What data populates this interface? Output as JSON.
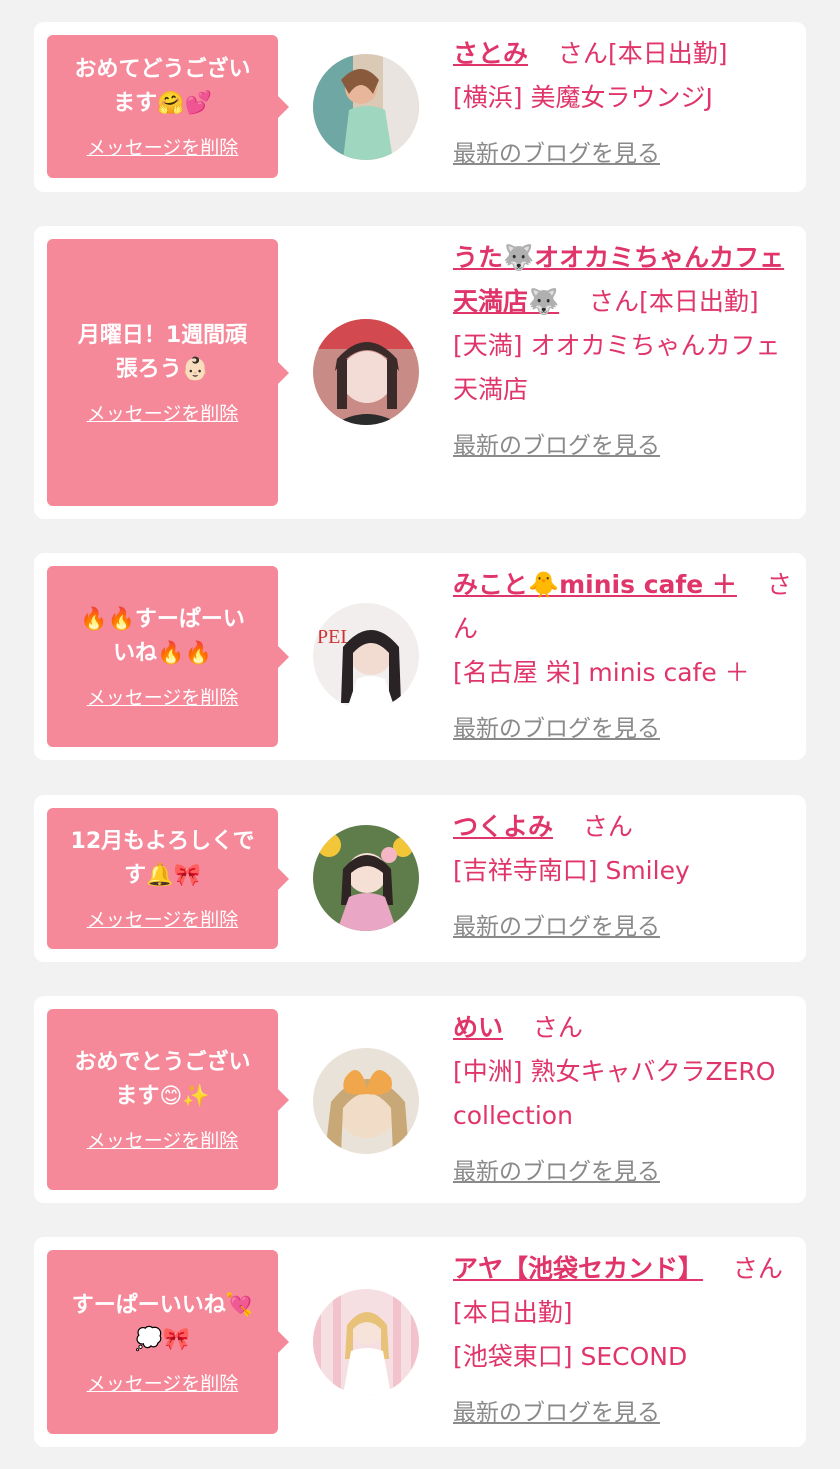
{
  "accent_color": "#e0356a",
  "bubble_color": "#f5899a",
  "delete_label": "メッセージを削除",
  "blog_label": "最新のブログを見る",
  "cards": [
    {
      "message": "おめてどうござい\nます🤗💕",
      "name": "さとみ",
      "honorific": "さん",
      "status": "[本日出勤]",
      "shop": "[横浜] 美魔女ラウンジJ",
      "avatar_icon": "avatar-photo"
    },
    {
      "message": "月曜日！1週間頑\n張ろう👶🏻",
      "name": "うた🐺オオカミちゃんカフェ天満店🐺",
      "honorific": "さん",
      "status": "[本日出勤]",
      "shop": "[天満] オオカミちゃんカフェ天満店",
      "avatar_icon": "avatar-photo"
    },
    {
      "message": "🔥🔥すーぱーい\nいね🔥🔥",
      "name": "みこと🐥minis cafe ＋",
      "honorific": "さん",
      "status": "",
      "shop": "[名古屋 栄] minis cafe ＋",
      "avatar_icon": "avatar-photo"
    },
    {
      "message": "12月もよろしくで\nす🔔🎀",
      "name": "つくよみ",
      "honorific": "さん",
      "status": "",
      "shop": "[吉祥寺南口] Smiley",
      "avatar_icon": "avatar-photo"
    },
    {
      "message": "おめでとうござい\nます😊✨",
      "name": "めい",
      "honorific": "さん",
      "status": "",
      "shop": "[中洲] 熟女キャバクラZERO collection",
      "avatar_icon": "avatar-photo"
    },
    {
      "message": "すーぱーいいね💘\n💭🎀",
      "name": "アヤ【池袋セカンド】",
      "honorific": "さん",
      "status": "[本日出勤]",
      "shop": "[池袋東口] SECOND",
      "avatar_icon": "avatar-photo"
    }
  ]
}
